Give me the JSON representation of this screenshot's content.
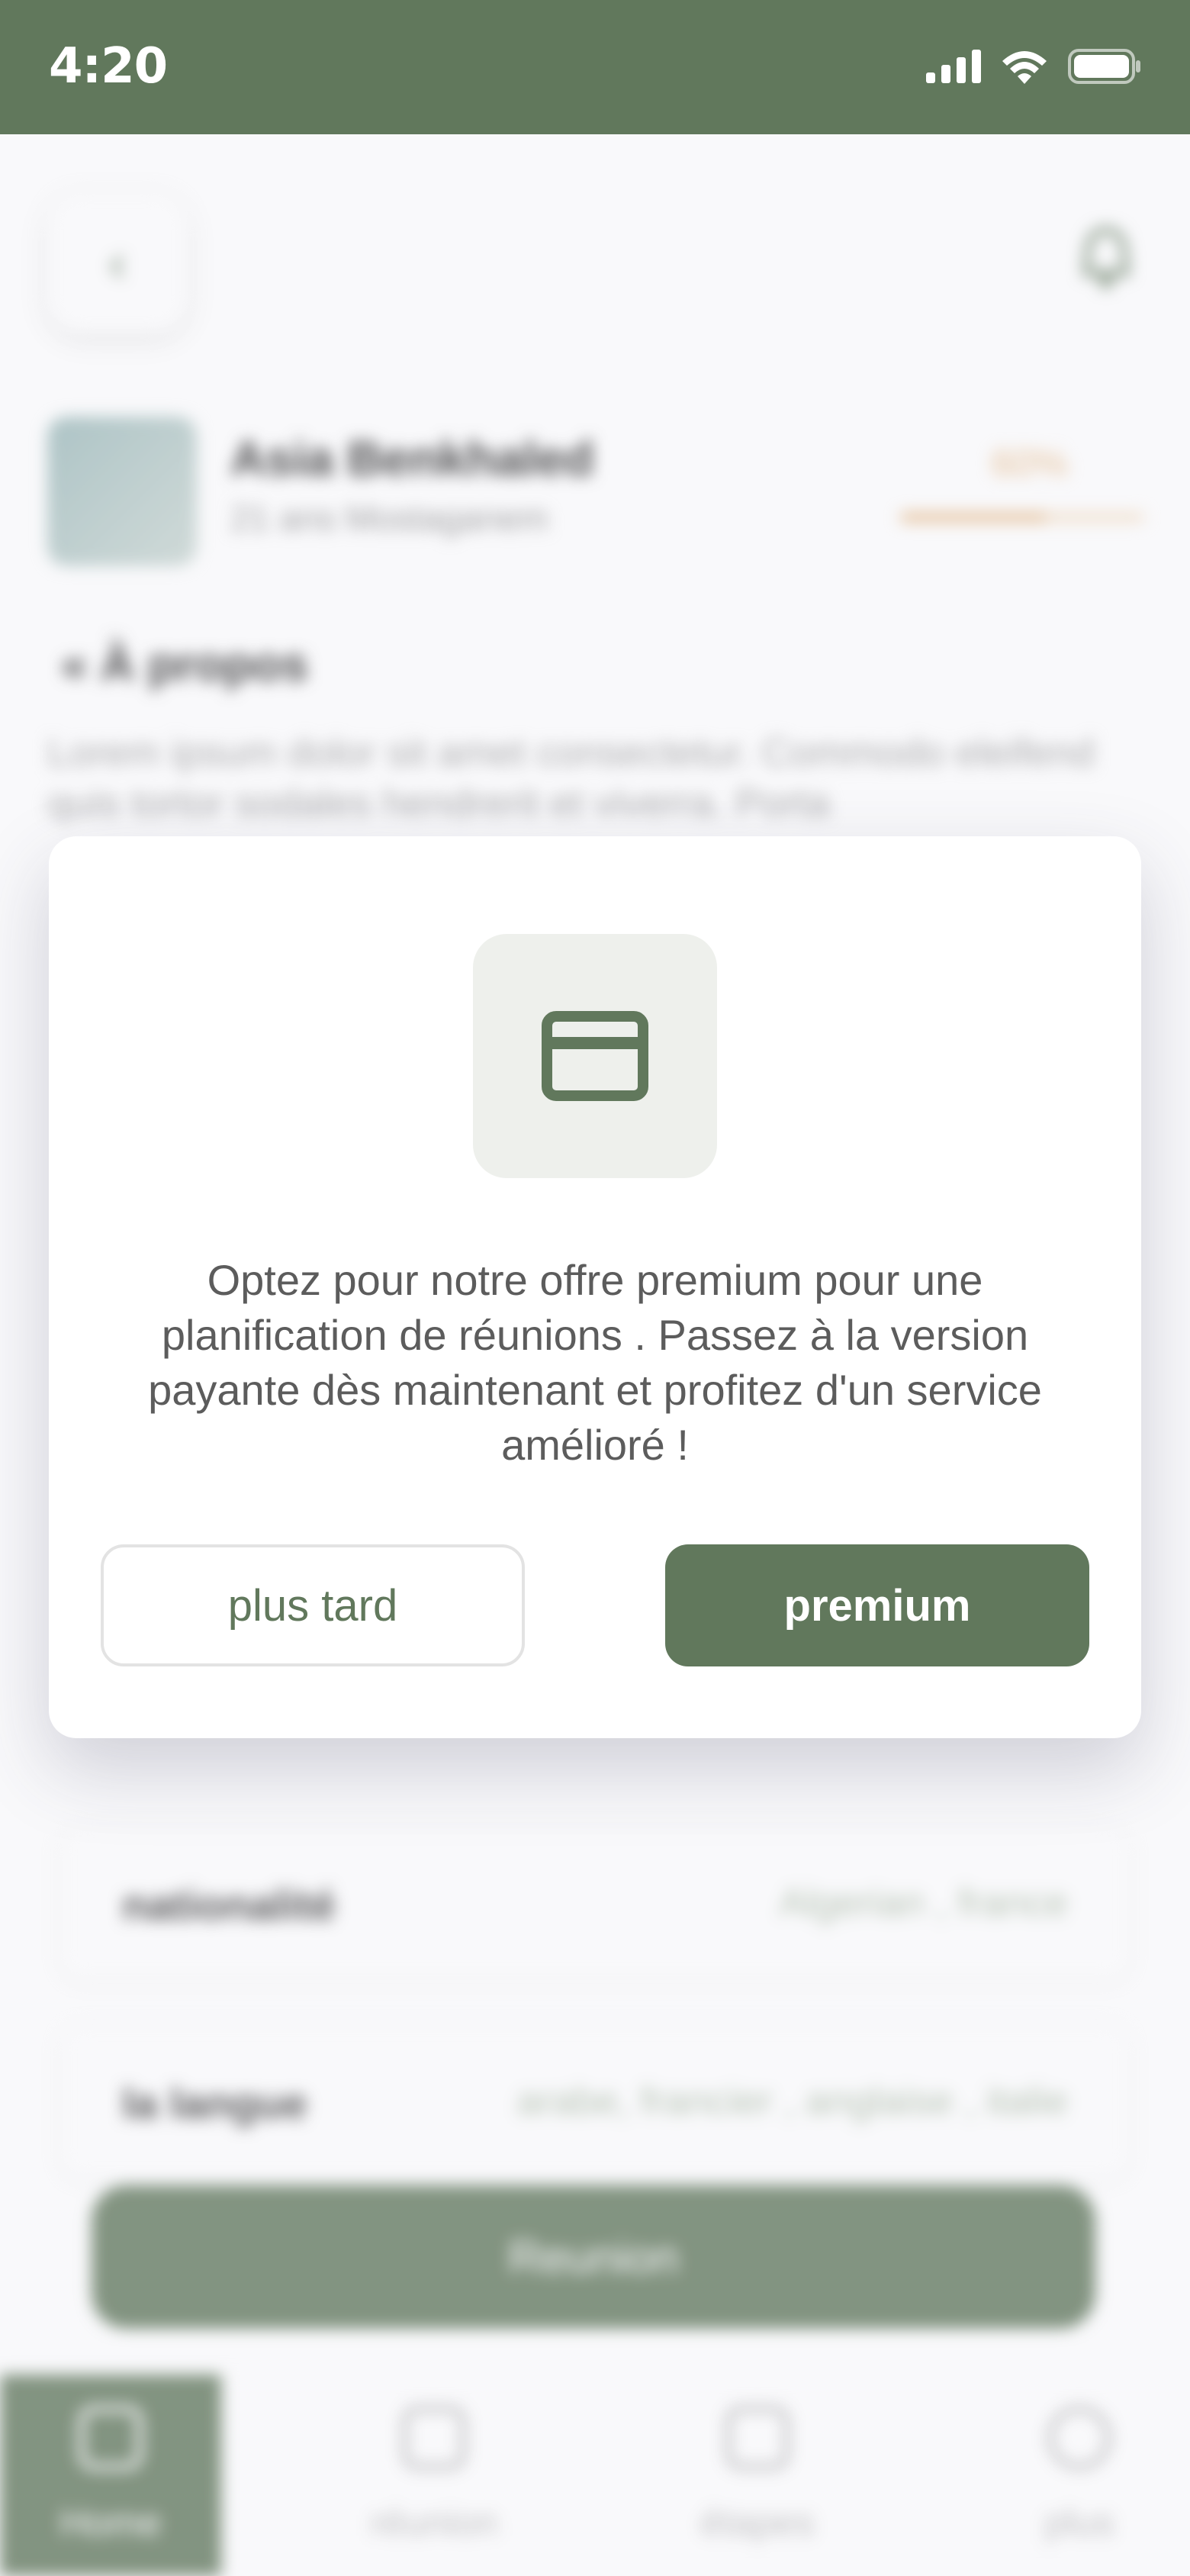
{
  "status_bar": {
    "time": "4:20",
    "icons": [
      "signal-icon",
      "wifi-icon",
      "battery-icon"
    ]
  },
  "colors": {
    "brand": "#61785c",
    "accent": "#e3b27b",
    "modal_icon_bg": "#eef0ec"
  },
  "header": {
    "back_icon": "chevron-left-icon",
    "notification_icon": "bell-icon"
  },
  "profile": {
    "name": "Asia Benkhaled",
    "subtitle": "21 ans Mostaganem",
    "completion": "60%",
    "completion_value": 0.6
  },
  "about": {
    "title": "« À propos",
    "text": "Lorem ipsum dolor sit amet consectetur. Commodo eleifend quis tortor sodales hendrerit et viverra. Porta"
  },
  "info": [
    {
      "label": "nationalité",
      "value": "Algerian , france"
    },
    {
      "label": "la langue",
      "value": "arabe, francier , anglaise , italie"
    }
  ],
  "reunion_button": "Reunion",
  "bottom_nav": [
    {
      "label": "Home",
      "icon": "home-icon",
      "active": true
    },
    {
      "label": "réunion",
      "icon": "calendar-icon",
      "active": false
    },
    {
      "label": "étapes",
      "icon": "list-icon",
      "active": false
    },
    {
      "label": "plus",
      "icon": "settings-icon",
      "active": false
    }
  ],
  "modal": {
    "icon": "credit-card-icon",
    "message": "Optez pour notre offre premium pour une planification de réunions . Passez à la version payante dès maintenant et profitez d'un service amélioré !",
    "later_label": "plus tard",
    "premium_label": "premium"
  }
}
